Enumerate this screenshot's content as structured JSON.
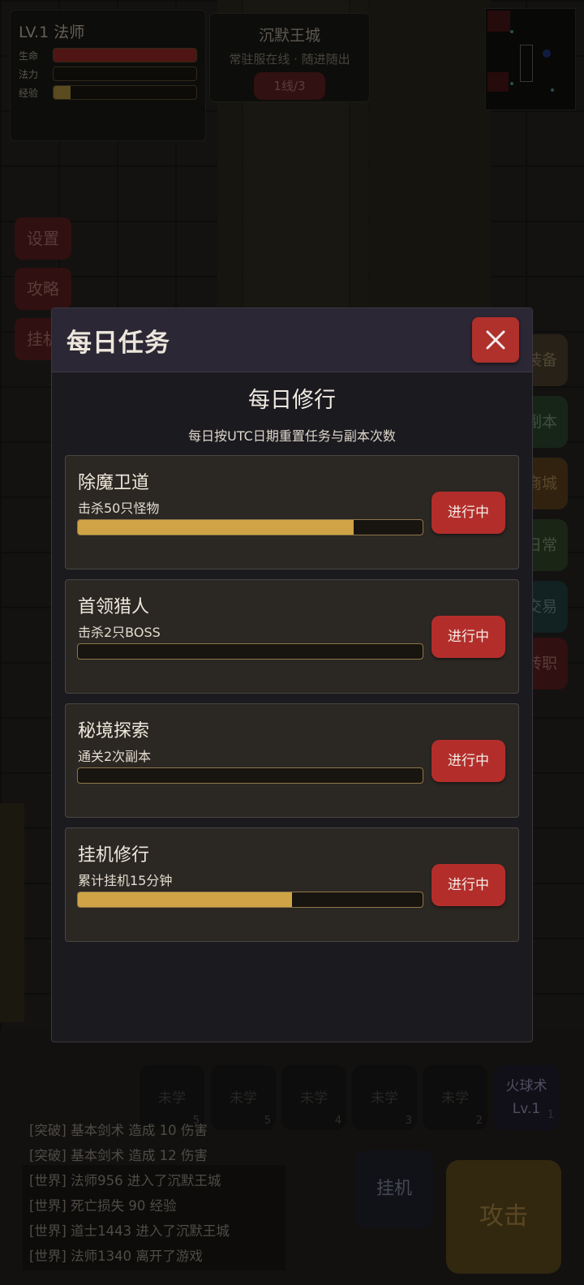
{
  "player": {
    "level_class": "LV.1 法师",
    "bars": [
      {
        "label": "生命",
        "fill": 1.0,
        "color": "#7a1f1f"
      },
      {
        "label": "法力",
        "fill": 0.0,
        "color": "#1f2f7a"
      },
      {
        "label": "经验",
        "fill": 0.12,
        "color": "#8a7432"
      }
    ]
  },
  "map": {
    "name": "沉默王城",
    "subtitle": "常驻服在线 · 随进随出",
    "line_button": "1线/3"
  },
  "left_menu": [
    "设置",
    "攻略",
    "挂机"
  ],
  "right_menu": [
    {
      "label": "装备",
      "color": "#3d3424"
    },
    {
      "label": "副本",
      "color": "#243a27"
    },
    {
      "label": "商城",
      "color": "#4a3517"
    },
    {
      "label": "日常",
      "color": "#2a3a22"
    },
    {
      "label": "交易",
      "color": "#1d3434"
    },
    {
      "label": "转职",
      "color": "#4b1919"
    }
  ],
  "skills": [
    {
      "label": "未学",
      "key": "5"
    },
    {
      "label": "未学",
      "key": "5"
    },
    {
      "label": "未学",
      "key": "4"
    },
    {
      "label": "未学",
      "key": "3"
    },
    {
      "label": "未学",
      "key": "2"
    },
    {
      "label": "火球术",
      "level": "Lv.1",
      "key": "1"
    }
  ],
  "actions": {
    "hang": "挂机",
    "attack": "攻击"
  },
  "chat": [
    "[突破] 基本剑术 造成 10 伤害",
    "[突破] 基本剑术 造成 12 伤害",
    "[世界] 法师956 进入了沉默王城",
    "[世界] 死亡损失 90 经验",
    "[世界] 道士1443 进入了沉默王城",
    "[世界] 法师1340 离开了游戏"
  ],
  "modal": {
    "title": "每日任务",
    "close_icon": "close-icon",
    "heading": "每日修行",
    "note": "每日按UTC日期重置任务与副本次数",
    "tasks": [
      {
        "name": "除魔卫道",
        "desc": "击杀50只怪物",
        "progress": 0.8,
        "status": "进行中"
      },
      {
        "name": "首领猎人",
        "desc": "击杀2只BOSS",
        "progress": 0.0,
        "status": "进行中"
      },
      {
        "name": "秘境探索",
        "desc": "通关2次副本",
        "progress": 0.0,
        "status": "进行中"
      },
      {
        "name": "挂机修行",
        "desc": "累计挂机15分钟",
        "progress": 0.62,
        "status": "进行中"
      }
    ]
  }
}
